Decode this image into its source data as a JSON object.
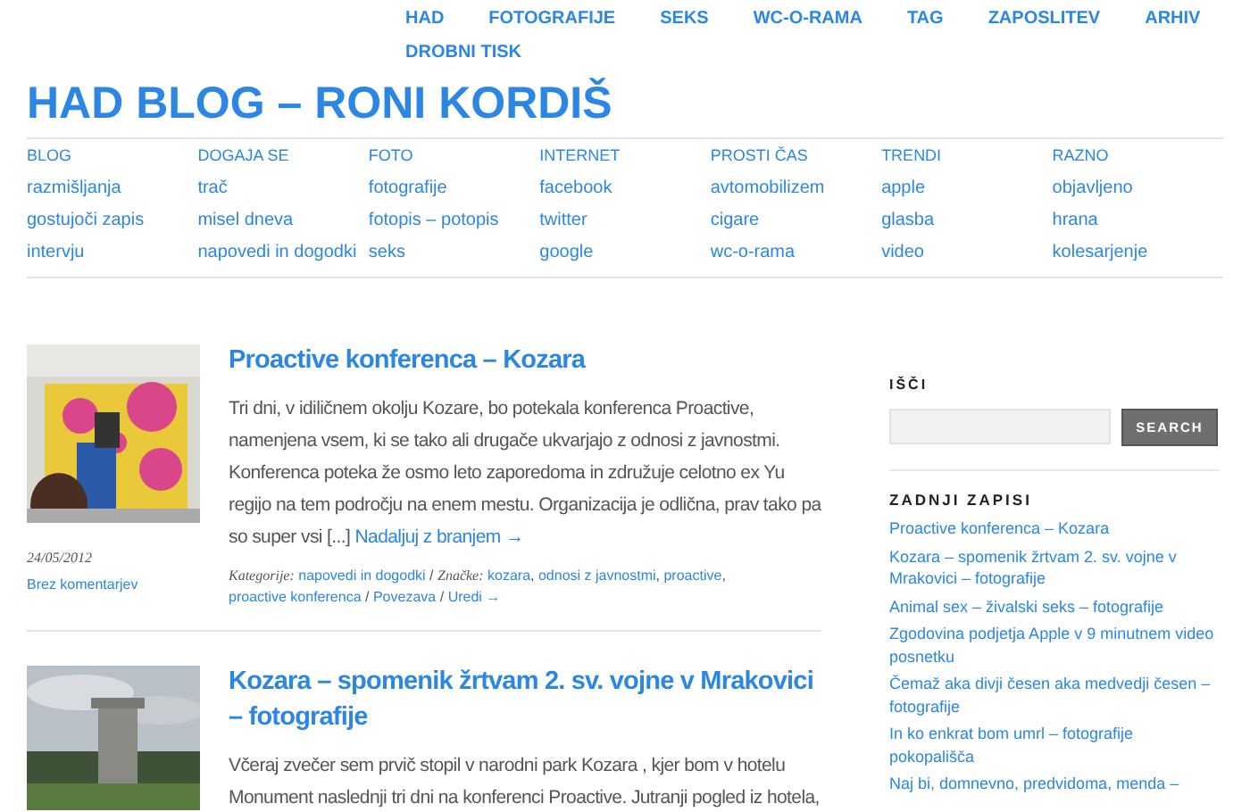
{
  "top_nav": [
    "HAD",
    "FOTOGRAFIJE",
    "SEKS",
    "WC-O-RAMA",
    "TAG",
    "ZAPOSLITEV",
    "ARHIV",
    "DROBNI TISK"
  ],
  "site_title": "HAD BLOG – RONI KORDIŠ",
  "mega_menu": [
    {
      "heading": "BLOG",
      "links": [
        "razmišljanja",
        "gostujoči zapis",
        "intervju"
      ]
    },
    {
      "heading": "DOGAJA SE",
      "links": [
        "trač",
        "misel dneva",
        "napovedi in dogodki"
      ]
    },
    {
      "heading": "FOTO",
      "links": [
        "fotografije",
        "fotopis – potopis",
        "seks"
      ]
    },
    {
      "heading": "INTERNET",
      "links": [
        "facebook",
        "twitter",
        "google"
      ]
    },
    {
      "heading": "PROSTI ČAS",
      "links": [
        "avtomobilizem",
        "cigare",
        "wc-o-rama"
      ]
    },
    {
      "heading": "TRENDI",
      "links": [
        "apple",
        "glasba",
        "video"
      ]
    },
    {
      "heading": "RAZNO",
      "links": [
        "objavljeno",
        "hrana",
        "kolesarjenje"
      ]
    }
  ],
  "posts": [
    {
      "kind": "conference",
      "title": "Proactive konferenca – Kozara",
      "excerpt": "Tri dni, v idiličnem okolju Kozare, bo potekala konferenca Proactive, namenjena vsem, ki se tako ali drugače ukvarjajo z odnosi z javnostmi. Konferenca poteka že osmo leto zaporedoma in združuje celotno ex Yu regijo na tem področju na enem mestu. Organizacija je odlična, prav tako pa so super vsi [...]",
      "read_more": "Nadaljuj z branjem →",
      "date": "24/05/2012",
      "comments": "Brez komentarjev",
      "categories_label": "Kategorije:",
      "categories": [
        "napovedi in dogodki"
      ],
      "tags_label": "Značke:",
      "tags": [
        "kozara",
        "odnosi z javnostmi",
        "proactive",
        "proactive konferenca"
      ],
      "links": [
        "Povezava",
        "Uredi →"
      ],
      "separator": "/",
      "tag_separator": ","
    },
    {
      "kind": "monument",
      "title": "Kozara – spomenik žrtvam 2. sv. vojne v Mrakovici – fotografije",
      "excerpt": "Včeraj zvečer sem prvič stopil v narodni park Kozara , kjer bom v hotelu Monument naslednji tri dni na konferenci Proactive. Jutranji pogled iz hotela,"
    }
  ],
  "sidebar": {
    "search": {
      "heading": "IŠČI",
      "button": "SEARCH"
    },
    "recent": {
      "heading": "ZADNJI ZAPISI",
      "items": [
        "Proactive konferenca – Kozara",
        "Kozara – spomenik žrtvam 2. sv. vojne v Mrakovici – fotografije",
        "Animal sex – živalski seks – fotografije",
        "Zgodovina podjetja Apple v 9 minutnem video posnetku",
        "Čemaž aka divji česen aka medvedji česen – fotografije",
        "In ko enkrat bom umrl – fotografije pokopališča",
        "Naj bi, domnevno, predvidoma, menda –"
      ]
    }
  }
}
